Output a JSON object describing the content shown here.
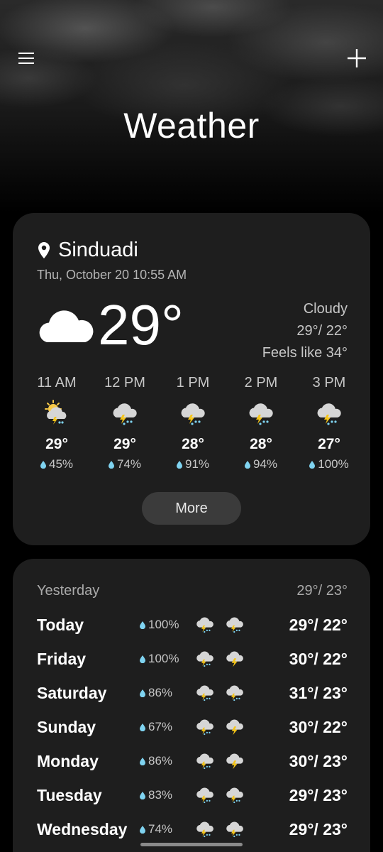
{
  "header": {
    "title": "Weather",
    "menu_icon": "hamburger-menu-icon",
    "add_icon": "plus-icon"
  },
  "current": {
    "location": "Sinduadi",
    "datetime": "Thu, October 20 10:55 AM",
    "temperature": "29°",
    "condition": "Cloudy",
    "high_low": "29°/ 22°",
    "feels_like": "Feels like 34°",
    "icon": "cloud-icon"
  },
  "hourly": [
    {
      "time": "11 AM",
      "temp": "29°",
      "precip": "45%",
      "icon": "sun-thunderstorm-icon"
    },
    {
      "time": "12 PM",
      "temp": "29°",
      "precip": "74%",
      "icon": "thunderstorm-icon"
    },
    {
      "time": "1 PM",
      "temp": "28°",
      "precip": "91%",
      "icon": "thunderstorm-icon"
    },
    {
      "time": "2 PM",
      "temp": "28°",
      "precip": "94%",
      "icon": "thunderstorm-icon"
    },
    {
      "time": "3 PM",
      "temp": "27°",
      "precip": "100%",
      "icon": "thunderstorm-icon"
    }
  ],
  "more_label": "More",
  "yesterday": {
    "label": "Yesterday",
    "temps": "29°/ 23°"
  },
  "daily": [
    {
      "day": "Today",
      "precip": "100%",
      "temps": "29°/ 22°"
    },
    {
      "day": "Friday",
      "precip": "100%",
      "temps": "30°/ 22°"
    },
    {
      "day": "Saturday",
      "precip": "86%",
      "temps": "31°/ 23°"
    },
    {
      "day": "Sunday",
      "precip": "67%",
      "temps": "30°/ 22°"
    },
    {
      "day": "Monday",
      "precip": "86%",
      "temps": "30°/ 23°"
    },
    {
      "day": "Tuesday",
      "precip": "83%",
      "temps": "29°/ 23°"
    },
    {
      "day": "Wednesday",
      "precip": "74%",
      "temps": "29°/ 23°"
    }
  ],
  "colors": {
    "card": "#1e1e1e",
    "drop": "#7fd3f0",
    "bolt": "#f5c518",
    "sun": "#f7c948"
  }
}
